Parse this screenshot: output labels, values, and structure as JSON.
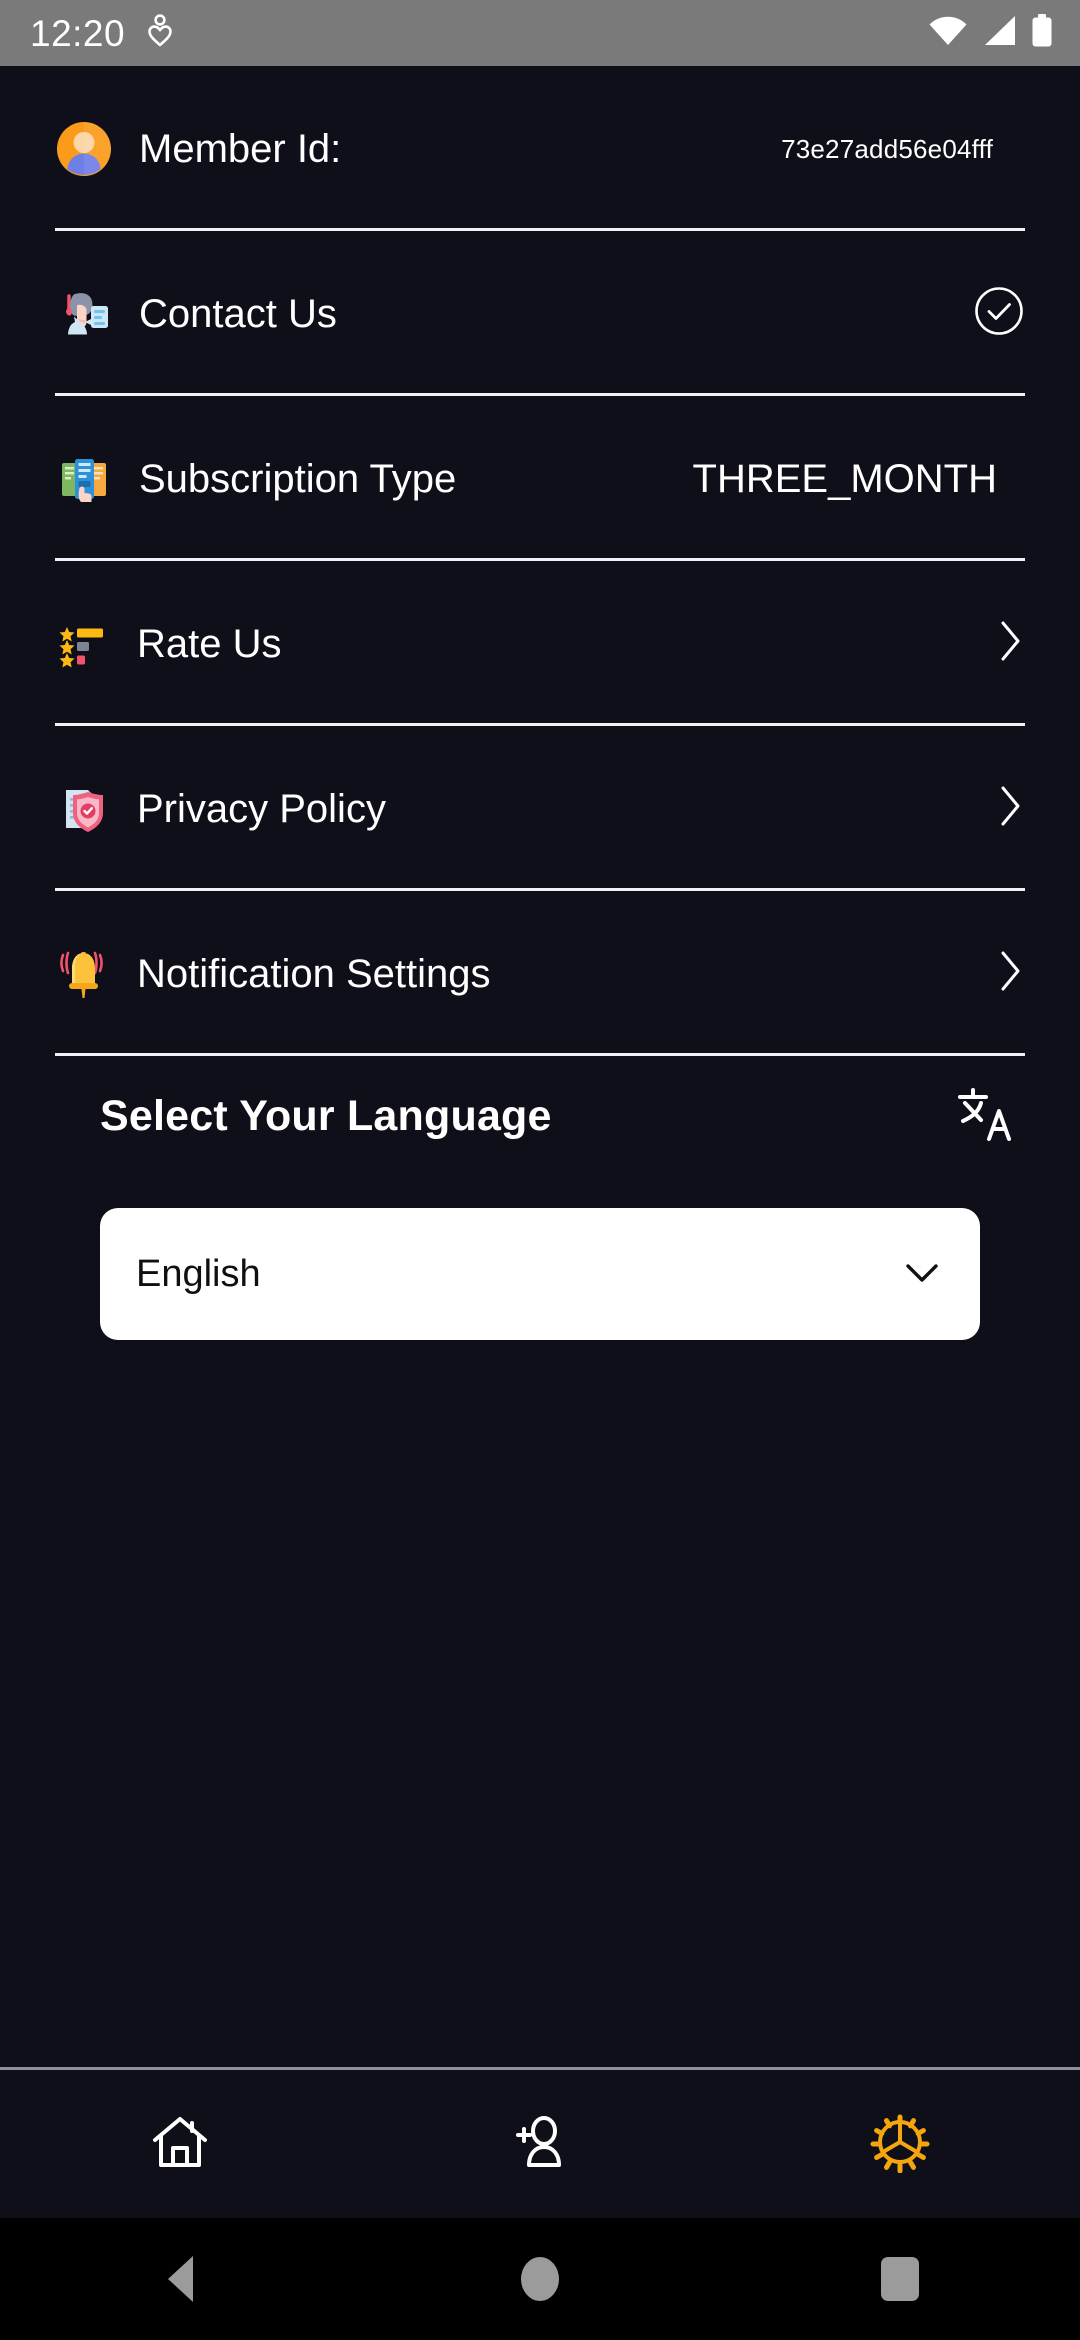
{
  "status_bar": {
    "clock": "12:20",
    "left_icons": [
      "heart-pin-icon"
    ],
    "right_icons": [
      "wifi-icon",
      "cellular-signal-icon",
      "battery-icon"
    ],
    "background_color": "#7a7a7a"
  },
  "theme": {
    "background": "#0e0f18",
    "text": "#ffffff",
    "divider": "#f1f1f5",
    "accent": "#f5a60f",
    "dropdown_background": "#ffffff",
    "dropdown_text": "#101010"
  },
  "rows": [
    {
      "icon": "member-avatar-icon",
      "label": "Member Id:",
      "value": "73e27add56e04fff",
      "trailing": "none"
    },
    {
      "icon": "support-agent-icon",
      "label": "Contact Us",
      "value": "",
      "trailing": "check-circle-icon"
    },
    {
      "icon": "subscription-cards-icon",
      "label": "Subscription Type",
      "value": "THREE_MONTH",
      "trailing": "none"
    },
    {
      "icon": "star-rating-icon",
      "label": "Rate Us",
      "value": "",
      "trailing": "chevron-right-icon"
    },
    {
      "icon": "privacy-shield-document-icon",
      "label": "Privacy Policy",
      "value": "",
      "trailing": "chevron-right-icon"
    },
    {
      "icon": "notification-bell-icon",
      "label": "Notification Settings",
      "value": "",
      "trailing": "chevron-right-icon"
    }
  ],
  "language": {
    "title": "Select Your Language",
    "icon": "translate-icon",
    "selected": "English",
    "chevron": "chevron-down-icon"
  },
  "app_nav": [
    {
      "icon": "home-icon",
      "active": false
    },
    {
      "icon": "add-person-icon",
      "active": false
    },
    {
      "icon": "gear-icon",
      "active": true
    }
  ],
  "system_nav": [
    {
      "icon": "back-icon"
    },
    {
      "icon": "home-circle-icon"
    },
    {
      "icon": "recents-square-icon"
    }
  ]
}
